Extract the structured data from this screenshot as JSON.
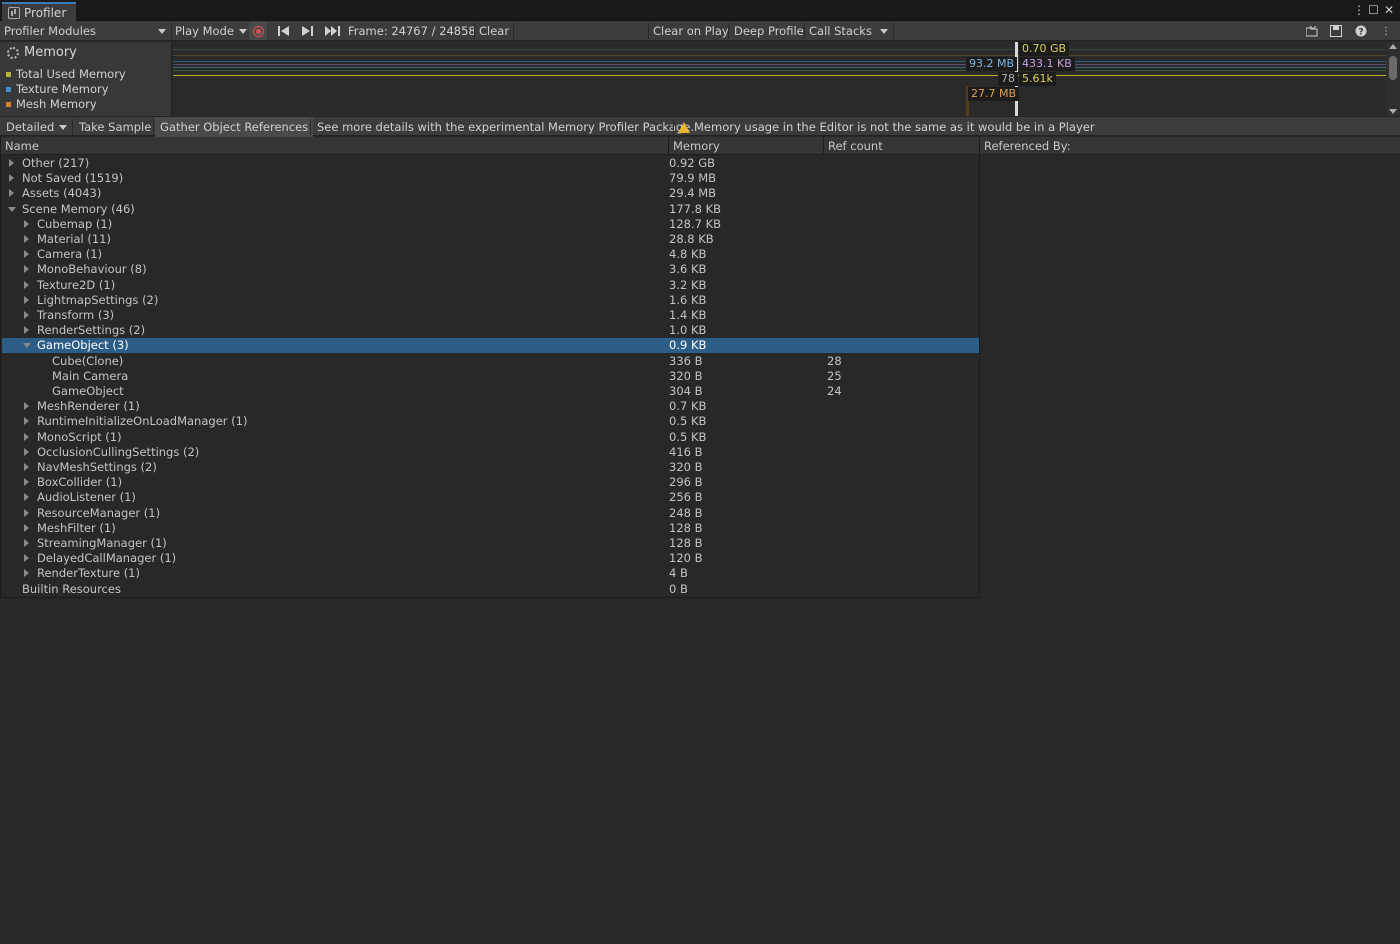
{
  "window": {
    "tab_title": "Profiler",
    "controls": [
      "⋮",
      "☐",
      "✕"
    ]
  },
  "toolbar": {
    "modules_dropdown": "Profiler Modules",
    "play_mode": "Play Mode",
    "frame": "Frame: 24767 / 24858",
    "clear": "Clear",
    "clear_on_play": "Clear on Play",
    "deep_profile": "Deep Profile",
    "call_stacks": "Call Stacks"
  },
  "module": {
    "title": "Memory",
    "legend": [
      {
        "label": "Total Used Memory",
        "color": "#b7b32e"
      },
      {
        "label": "Texture Memory",
        "color": "#3f8fd4"
      },
      {
        "label": "Mesh Memory",
        "color": "#d47e2e"
      }
    ]
  },
  "chart_labels": {
    "total": "0.70 GB",
    "texture": "93.2 MB",
    "texture2": "433.1 KB",
    "count": "78",
    "count2": "5.61k",
    "mesh": "27.7 MB"
  },
  "detail_toolbar": {
    "view_mode": "Detailed",
    "take_sample": "Take Sample",
    "gather_refs": "Gather Object References",
    "info": "See more details with the experimental Memory Profiler Package.",
    "warning": "Memory usage in the Editor is not the same as it would be in a Player"
  },
  "table": {
    "columns": [
      "Name",
      "Memory",
      "Ref count",
      "Referenced By:"
    ],
    "rows": [
      {
        "name": "Other (217)",
        "memory": "0.92 GB",
        "ref": "",
        "depth": 0,
        "expand": "closed"
      },
      {
        "name": "Not Saved (1519)",
        "memory": "79.9 MB",
        "ref": "",
        "depth": 0,
        "expand": "closed"
      },
      {
        "name": "Assets (4043)",
        "memory": "29.4 MB",
        "ref": "",
        "depth": 0,
        "expand": "closed"
      },
      {
        "name": "Scene Memory (46)",
        "memory": "177.8 KB",
        "ref": "",
        "depth": 0,
        "expand": "open"
      },
      {
        "name": "Cubemap (1)",
        "memory": "128.7 KB",
        "ref": "",
        "depth": 1,
        "expand": "closed"
      },
      {
        "name": "Material (11)",
        "memory": "28.8 KB",
        "ref": "",
        "depth": 1,
        "expand": "closed"
      },
      {
        "name": "Camera (1)",
        "memory": "4.8 KB",
        "ref": "",
        "depth": 1,
        "expand": "closed"
      },
      {
        "name": "MonoBehaviour (8)",
        "memory": "3.6 KB",
        "ref": "",
        "depth": 1,
        "expand": "closed"
      },
      {
        "name": "Texture2D (1)",
        "memory": "3.2 KB",
        "ref": "",
        "depth": 1,
        "expand": "closed"
      },
      {
        "name": "LightmapSettings (2)",
        "memory": "1.6 KB",
        "ref": "",
        "depth": 1,
        "expand": "closed"
      },
      {
        "name": "Transform (3)",
        "memory": "1.4 KB",
        "ref": "",
        "depth": 1,
        "expand": "closed"
      },
      {
        "name": "RenderSettings (2)",
        "memory": "1.0 KB",
        "ref": "",
        "depth": 1,
        "expand": "closed"
      },
      {
        "name": "GameObject (3)",
        "memory": "0.9 KB",
        "ref": "",
        "depth": 1,
        "expand": "open",
        "selected": true
      },
      {
        "name": "Cube(Clone)",
        "memory": "336 B",
        "ref": "28",
        "depth": 2,
        "expand": "none"
      },
      {
        "name": "Main Camera",
        "memory": "320 B",
        "ref": "25",
        "depth": 2,
        "expand": "none"
      },
      {
        "name": "GameObject",
        "memory": "304 B",
        "ref": "24",
        "depth": 2,
        "expand": "none"
      },
      {
        "name": "MeshRenderer (1)",
        "memory": "0.7 KB",
        "ref": "",
        "depth": 1,
        "expand": "closed"
      },
      {
        "name": "RuntimeInitializeOnLoadManager (1)",
        "memory": "0.5 KB",
        "ref": "",
        "depth": 1,
        "expand": "closed"
      },
      {
        "name": "MonoScript (1)",
        "memory": "0.5 KB",
        "ref": "",
        "depth": 1,
        "expand": "closed"
      },
      {
        "name": "OcclusionCullingSettings (2)",
        "memory": "416 B",
        "ref": "",
        "depth": 1,
        "expand": "closed"
      },
      {
        "name": "NavMeshSettings (2)",
        "memory": "320 B",
        "ref": "",
        "depth": 1,
        "expand": "closed"
      },
      {
        "name": "BoxCollider (1)",
        "memory": "296 B",
        "ref": "",
        "depth": 1,
        "expand": "closed"
      },
      {
        "name": "AudioListener (1)",
        "memory": "256 B",
        "ref": "",
        "depth": 1,
        "expand": "closed"
      },
      {
        "name": "ResourceManager (1)",
        "memory": "248 B",
        "ref": "",
        "depth": 1,
        "expand": "closed"
      },
      {
        "name": "MeshFilter (1)",
        "memory": "128 B",
        "ref": "",
        "depth": 1,
        "expand": "closed"
      },
      {
        "name": "StreamingManager (1)",
        "memory": "128 B",
        "ref": "",
        "depth": 1,
        "expand": "closed"
      },
      {
        "name": "DelayedCallManager (1)",
        "memory": "120 B",
        "ref": "",
        "depth": 1,
        "expand": "closed"
      },
      {
        "name": "RenderTexture (1)",
        "memory": "4 B",
        "ref": "",
        "depth": 1,
        "expand": "closed"
      },
      {
        "name": "Builtin Resources",
        "memory": "0 B",
        "ref": "",
        "depth": 0,
        "expand": "none"
      }
    ]
  }
}
